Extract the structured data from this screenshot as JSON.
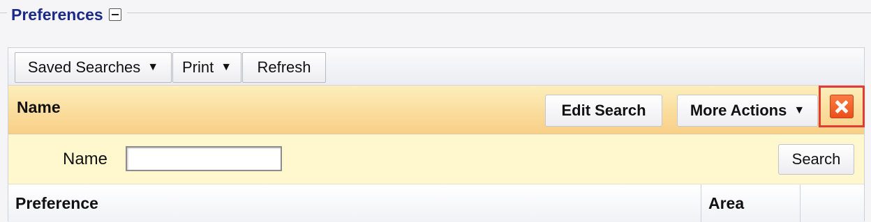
{
  "section": {
    "title": "Preferences"
  },
  "toolbar": {
    "saved_searches_label": "Saved Searches",
    "print_label": "Print",
    "refresh_label": "Refresh",
    "dropdown_caret": "▼"
  },
  "header": {
    "title": "Name",
    "edit_search_label": "Edit Search",
    "more_actions_label": "More Actions",
    "dropdown_caret": "▼"
  },
  "search_form": {
    "name_label": "Name",
    "name_value": "",
    "search_button_label": "Search"
  },
  "table": {
    "columns": [
      "Preference",
      "Area",
      ""
    ]
  },
  "colors": {
    "section_title": "#1b2a8a",
    "header_bar_top": "#fdeebb",
    "header_bar_bottom": "#f8cf86",
    "search_row_bg": "#fff8cf",
    "close_icon": "#ea4f1c",
    "highlight_border": "#e23b33"
  },
  "icons": {
    "collapse": "minus-icon",
    "close": "close-icon",
    "caret": "chevron-down-icon"
  }
}
